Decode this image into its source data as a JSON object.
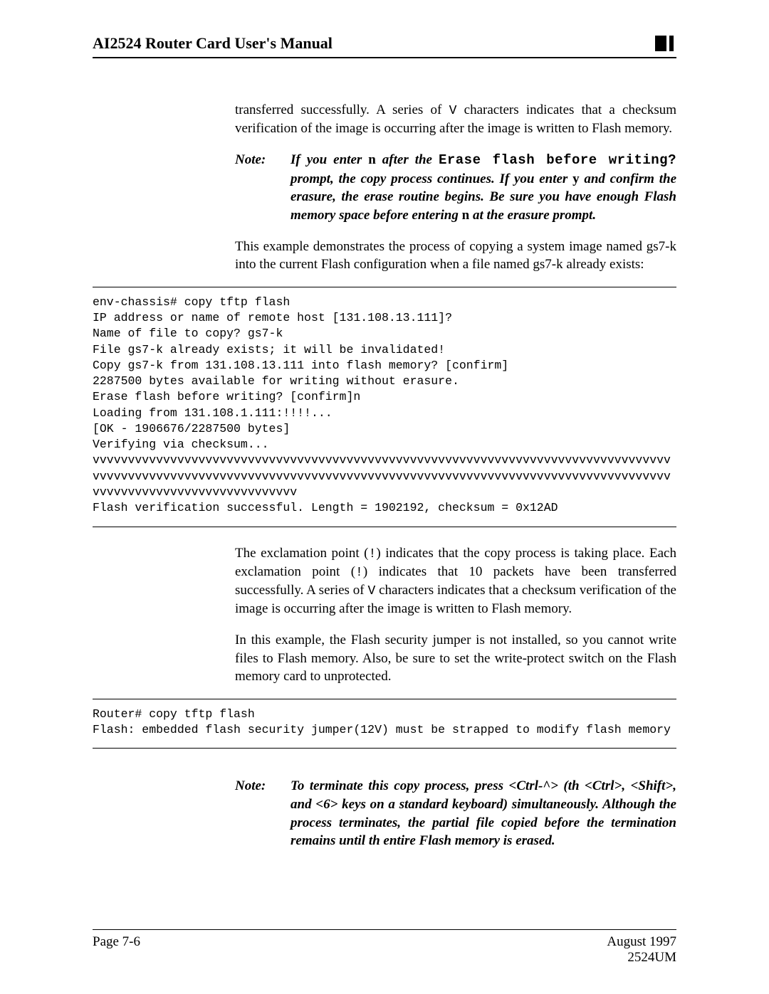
{
  "header": {
    "title": "AI2524 Router Card User's Manual"
  },
  "body": {
    "para1_a": "transferred successfully. A series of ",
    "para1_b": " characters indicates that a checksum verification of the image is occurring after the image is written to Flash memory.",
    "v_char": "V",
    "note1": {
      "label": "Note:",
      "a": "If you enter ",
      "n": "n",
      "b": " after the ",
      "code1": "Erase flash before writing?",
      "c": " prompt, the copy process continues. If you enter ",
      "y": "y",
      "d": " and confirm the erasure, the erase routine begins. Be sure you have enough Flash memory space before entering ",
      "e": " at the erasure prompt."
    },
    "para2": "This example demonstrates the process of copying a system image named gs7-k into the current Flash configuration when a file named gs7-k already exists:",
    "code1": "env-chassis# copy tftp flash\nIP address or name of remote host [131.108.13.111]?\nName of file to copy? gs7-k\nFile gs7-k already exists; it will be invalidated!\nCopy gs7-k from 131.108.13.111 into flash memory? [confirm]\n2287500 bytes available for writing without erasure.\nErase flash before writing? [confirm]n\nLoading from 131.108.1.111:!!!!...\n[OK - 1906676/2287500 bytes]\nVerifying via checksum...\nvvvvvvvvvvvvvvvvvvvvvvvvvvvvvvvvvvvvvvvvvvvvvvvvvvvvvvvvvvvvvvvvvvvvvvvvvvvvvvvvvv\nvvvvvvvvvvvvvvvvvvvvvvvvvvvvvvvvvvvvvvvvvvvvvvvvvvvvvvvvvvvvvvvvvvvvvvvvvvvvvvvvvv\nvvvvvvvvvvvvvvvvvvvvvvvvvvvvv\nFlash verification successful. Length = 1902192, checksum = 0x12AD",
    "para3_a": "The exclamation point (",
    "para3_b": ") indicates that the copy process is taking place. Each exclamation point (",
    "para3_c": ") indicates that   10 packets have been transferred successfully. A series of ",
    "para3_d": " characters indicates that a checksum verification of the image is occurring after the image is written to Flash memory.",
    "bang": "!",
    "para4": "In this example, the Flash security jumper is not installed, so you cannot write files to Flash memory. Also, be sure to set the write-protect switch on the Flash memory card to unprotected.",
    "code2": "Router# copy tftp flash\nFlash: embedded flash security jumper(12V) must be strapped to modify flash memory",
    "note2": {
      "label": "Note:",
      "text": "To terminate this copy process, press <Ctrl-^> (th <Ctrl>, <Shift>, and <6> keys on a standard keyboard) simultaneously. Although the process terminates, the partial file copied before the termination remains until th entire Flash memory is erased."
    }
  },
  "footer": {
    "page": "Page 7-6",
    "date": "August 1997",
    "docnum": "2524UM"
  }
}
